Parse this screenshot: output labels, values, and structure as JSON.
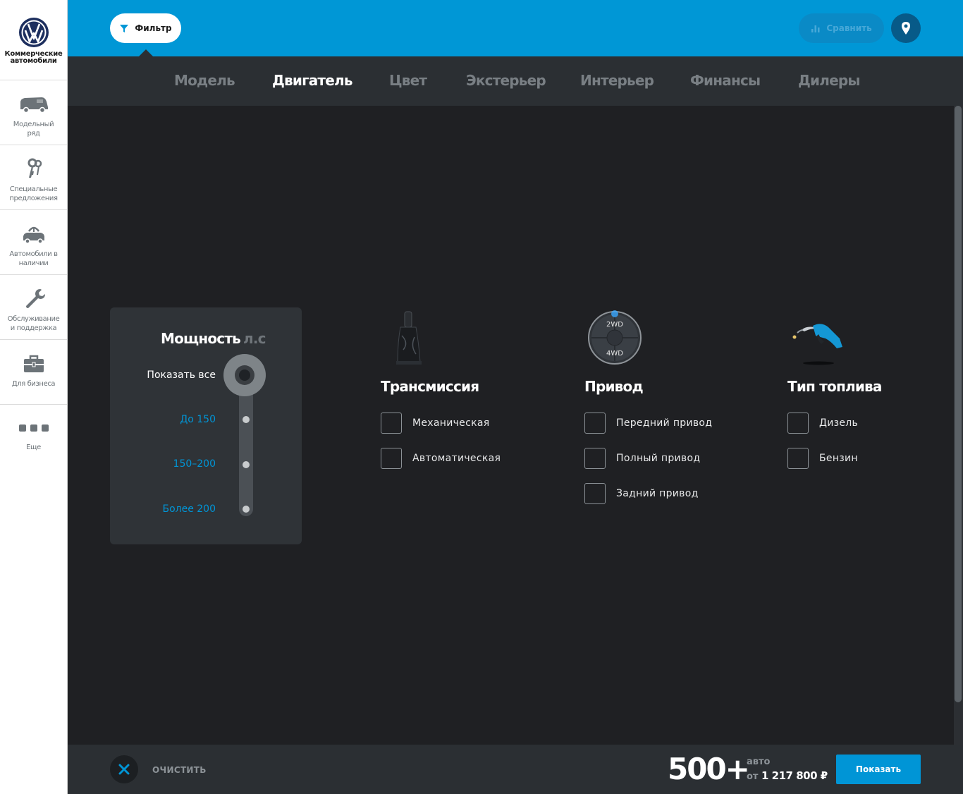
{
  "brand": {
    "line1": "Коммерческие",
    "line2": "автомобили"
  },
  "sidebar": {
    "items": [
      {
        "label": "Модельный\nряд",
        "icon": "van-icon"
      },
      {
        "label": "Специальные\nпредложения",
        "icon": "keys-icon"
      },
      {
        "label": "Автомобили в\nналичии",
        "icon": "car-stock-icon"
      },
      {
        "label": "Обслуживание\nи поддержка",
        "icon": "wrench-icon"
      },
      {
        "label": "Для бизнеса",
        "icon": "briefcase-icon"
      },
      {
        "label": "Еще",
        "icon": "more-icon"
      }
    ]
  },
  "topbar": {
    "filter_label": "Фильтр",
    "compare_label": "Сравнить"
  },
  "tabs": [
    {
      "label": "Модель",
      "active": false
    },
    {
      "label": "Двигатель",
      "active": true
    },
    {
      "label": "Цвет",
      "active": false
    },
    {
      "label": "Экстерьер",
      "active": false
    },
    {
      "label": "Интерьер",
      "active": false
    },
    {
      "label": "Финансы",
      "active": false
    },
    {
      "label": "Дилеры",
      "active": false
    }
  ],
  "power": {
    "title": "Мощность",
    "unit": "л.с",
    "options": [
      "Показать все",
      "До 150",
      "150–200",
      "Более 200"
    ],
    "selected_index": 0
  },
  "transmission": {
    "title": "Трансмиссия",
    "options": [
      "Механическая",
      "Автоматическая"
    ]
  },
  "drive": {
    "title": "Привод",
    "icon_text_top": "2WD",
    "icon_text_bottom": "4WD",
    "options": [
      "Передний привод",
      "Полный привод",
      "Задний привод"
    ]
  },
  "fuel": {
    "title": "Тип топлива",
    "options": [
      "Дизель",
      "Бензин"
    ]
  },
  "bottom": {
    "clear_label": "ОЧИСТИТЬ",
    "count": "500+",
    "count_unit": "авто",
    "price_prefix": "от",
    "price": "1 217 800 ₽",
    "show_label": "Показать"
  },
  "colors": {
    "accent": "#0097d6",
    "background": "#1f2023",
    "panel": "#2b2f33"
  }
}
